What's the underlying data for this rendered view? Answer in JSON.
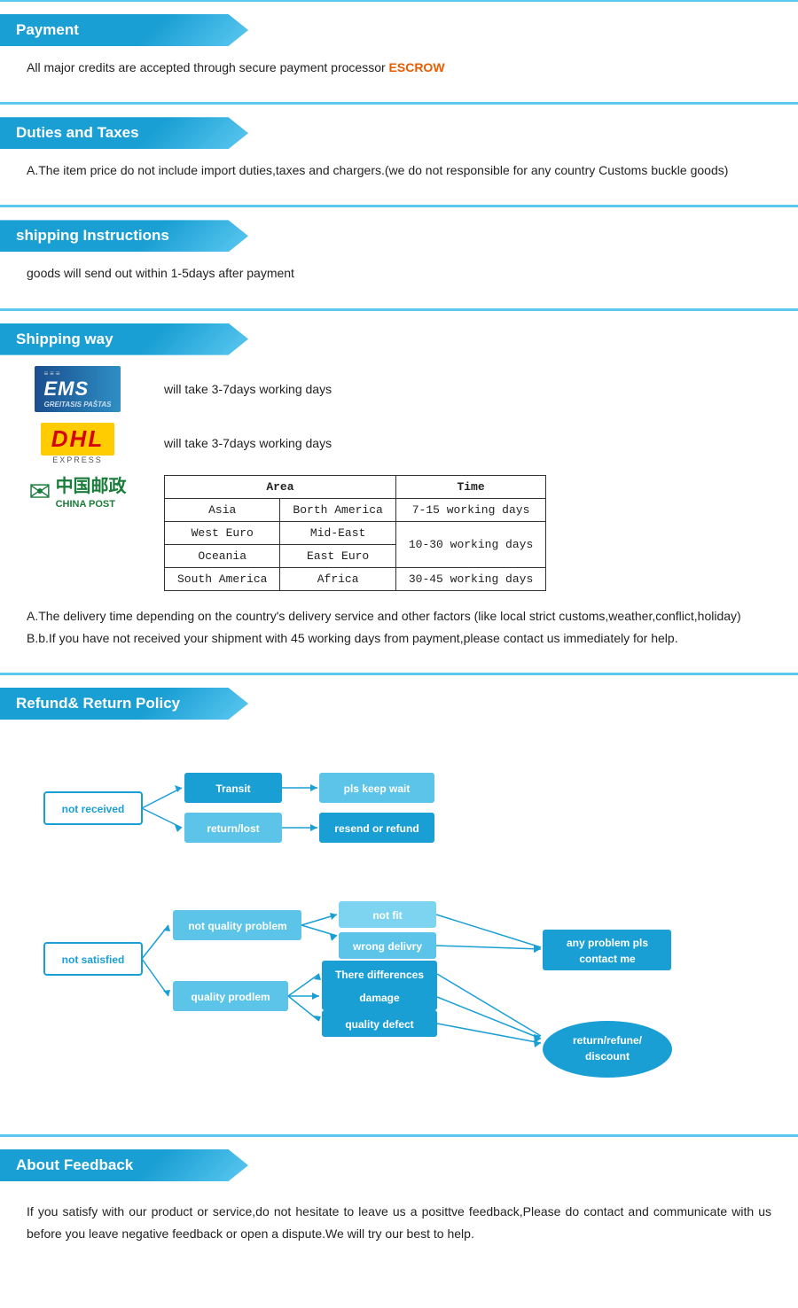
{
  "sections": {
    "payment": {
      "header": "Payment",
      "text": "All  major  credits  are  accepted  through  secure  payment  processor",
      "highlight": "ESCROW"
    },
    "duties": {
      "header": "Duties  and  Taxes",
      "text": "A.The  item  price  do  not  include  import  duties,taxes  and  chargers.(we  do  not  responsible  for  any  country  Customs  buckle  goods)"
    },
    "shipping_instructions": {
      "header": "shipping  Instructions",
      "text": "goods  will  send  out  within  1-5days  after  payment"
    },
    "shipping_way": {
      "header": "Shipping  way",
      "ems_text": "will  take  3-7days  working  days",
      "dhl_text": "will  take  3-7days  working  days",
      "chinapost_table": {
        "headers": [
          "Area",
          "",
          "Time"
        ],
        "rows": [
          [
            "Asia",
            "Borth America",
            "7-15 working days"
          ],
          [
            "West Euro",
            "Mid-East",
            "10-30 working days"
          ],
          [
            "Oceania",
            "East Euro",
            ""
          ],
          [
            "South America",
            "Africa",
            "30-45 working days"
          ]
        ]
      },
      "note_a": "A.The  delivery  time  depending  on  the  country's  delivery  service  and  other  factors  (like  local  strict  customs,weather,conflict,holiday)",
      "note_b": "B.b.If  you  have  not  received  your  shipment  with  45  working  days  from  payment,please  contact  us  immediately  for  help."
    },
    "refund": {
      "header": "Refund&  Return  Policy",
      "flow": {
        "not_received": "not  received",
        "transit": "Transit",
        "pls_keep_wait": "pls  keep  wait",
        "return_lost": "return/lost",
        "resend_or_refund": "resend  or  refund",
        "not_satisfied": "not  satisfied",
        "not_quality_problem": "not  quality  problem",
        "not_fit": "not  fit",
        "wrong_delivry": "wrong  delivry",
        "any_problem": "any  problem  pls\ncontact  me",
        "quality_prodlem": "quality  prodlem",
        "there_differences": "There  differences",
        "damage": "damage",
        "quality_defect": "quality  defect",
        "return_refune_discount": "return/refune/\ndiscount"
      }
    },
    "feedback": {
      "header": "About  Feedback",
      "text": "If  you  satisfy  with  our  product  or  service,do  not  hesitate  to  leave  us  a  posittve  feedback,Please  do  contact  and  communicate  with  us  before  you  leave  negative  feedback  or  open  a  dispute.We  will  try  our  best  to  help."
    }
  }
}
